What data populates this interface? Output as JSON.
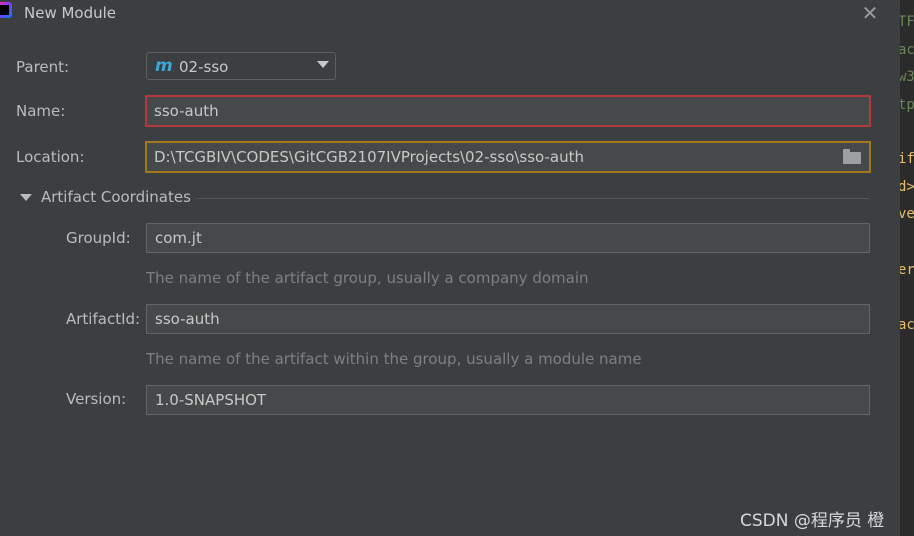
{
  "dialog": {
    "title": "New Module",
    "close_glyph": "✕"
  },
  "form": {
    "parent": {
      "label": "Parent:",
      "icon": "maven-module-icon",
      "icon_glyph": "m",
      "value": "02-sso"
    },
    "name": {
      "label": "Name:",
      "value": "sso-auth"
    },
    "location": {
      "label": "Location:",
      "value": "D:\\TCGBIV\\CODES\\GitCGB2107IVProjects\\02-sso\\sso-auth"
    }
  },
  "artifact": {
    "section_title": "Artifact Coordinates",
    "group_id": {
      "label": "GroupId:",
      "value": "com.jt",
      "hint": "The name of the artifact group, usually a company domain"
    },
    "artifact_id": {
      "label": "ArtifactId:",
      "value": "sso-auth",
      "hint": "The name of the artifact within the group, usually a module name"
    },
    "version": {
      "label": "Version:",
      "value": "1.0-SNAPSHOT"
    }
  },
  "background_editor": {
    "fragments": [
      "TF",
      "ac",
      "w3",
      "tp",
      "if",
      "d>",
      "ve",
      "er",
      "ac"
    ]
  },
  "watermark": "CSDN @程序员 橙",
  "colors": {
    "dialog_bg": "#3c3f41",
    "field_bg": "#45494a",
    "error_border": "#b33a3a",
    "warning_border": "#a3781c",
    "hint_text": "#7f7f7f",
    "maven_icon": "#3ea5d6"
  }
}
